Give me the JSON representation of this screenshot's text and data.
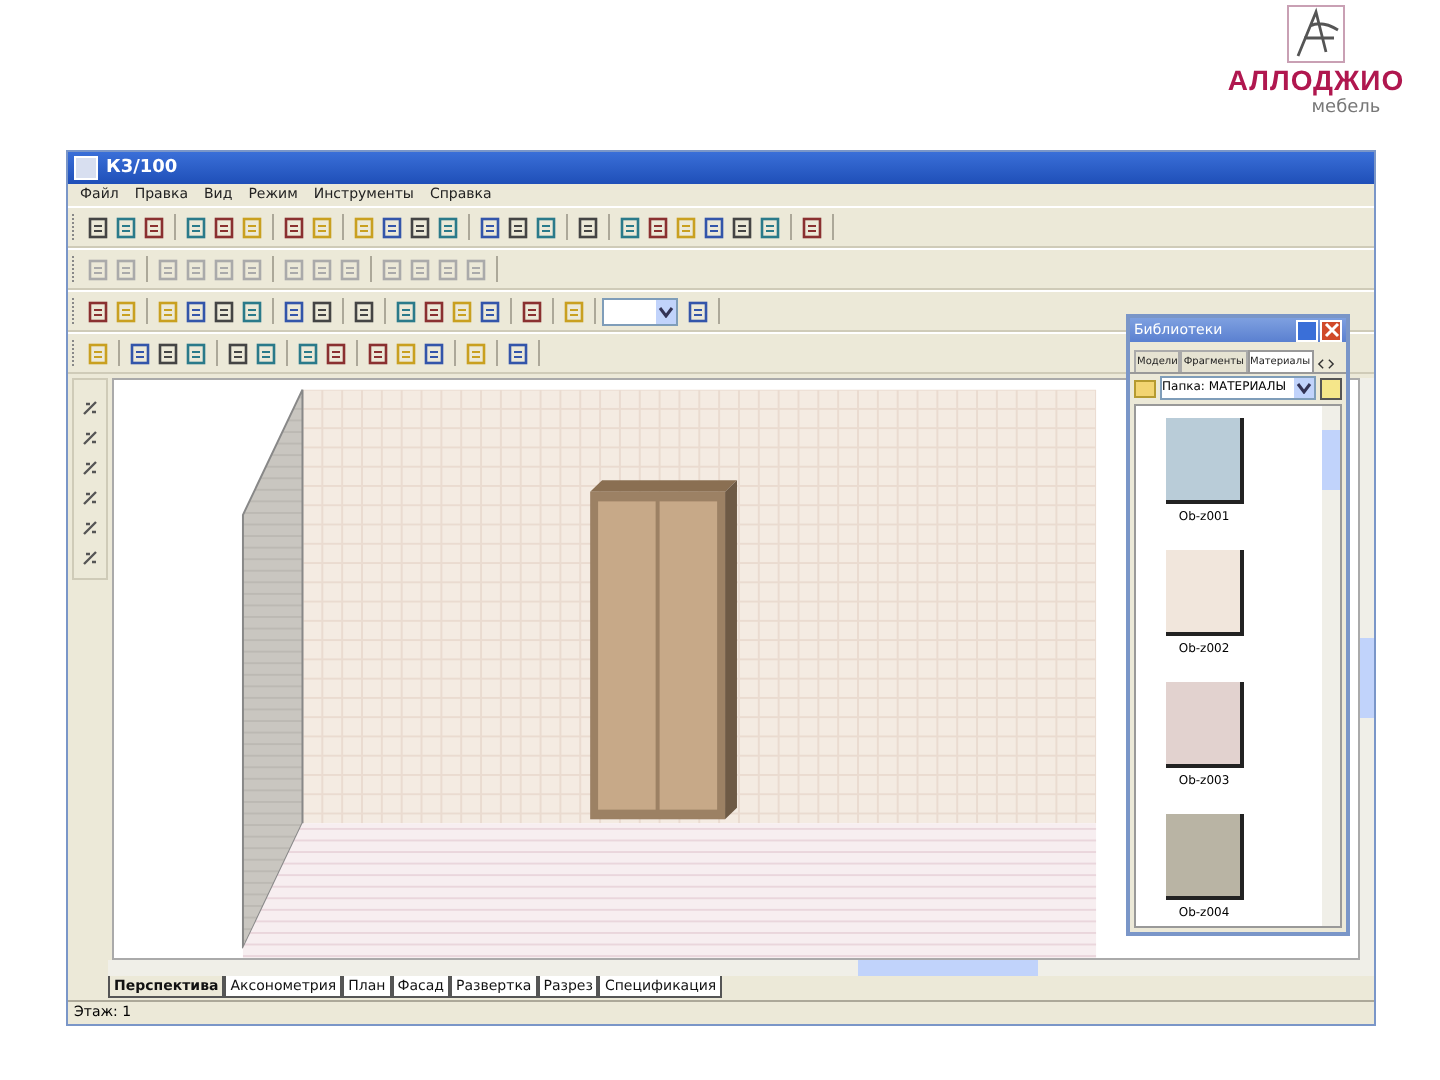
{
  "logo": {
    "brand": "АЛЛОДЖИО",
    "subtitle": "мебель"
  },
  "window": {
    "title": "К3/100"
  },
  "menu": [
    "Файл",
    "Правка",
    "Вид",
    "Режим",
    "Инструменты",
    "Справка"
  ],
  "library": {
    "title": "Библиотеки",
    "tabs": [
      {
        "label": "Модели",
        "selected": false
      },
      {
        "label": "Фрагменты",
        "selected": false
      },
      {
        "label": "Материалы",
        "selected": true
      }
    ],
    "path": "Папка: МАТЕРИАЛЫ",
    "items": [
      {
        "label": "Ob-z001",
        "color": "#b9ccd8"
      },
      {
        "label": "Ob-z002",
        "color": "#f1e6dc"
      },
      {
        "label": "Ob-z003",
        "color": "#e2d2cf"
      },
      {
        "label": "Ob-z004",
        "color": "#b9b4a4"
      }
    ]
  },
  "view_tabs": [
    {
      "label": "Перспектива",
      "selected": true
    },
    {
      "label": "Аксонометрия",
      "selected": false
    },
    {
      "label": "План",
      "selected": false
    },
    {
      "label": "Фасад",
      "selected": false
    },
    {
      "label": "Развертка",
      "selected": false
    },
    {
      "label": "Разрез",
      "selected": false
    },
    {
      "label": "Спецификация",
      "selected": false
    }
  ],
  "status_bar": "Этаж: 1"
}
